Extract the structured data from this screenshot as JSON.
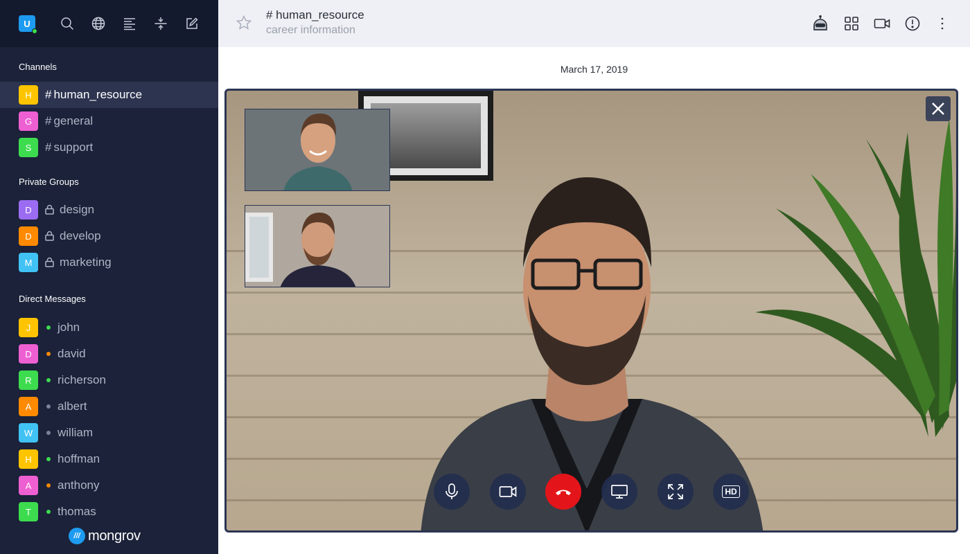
{
  "user": {
    "initial": "U",
    "status_color": "#3ee04a"
  },
  "toolbar": {
    "icons": [
      "search-icon",
      "globe-icon",
      "align-left-icon",
      "split-icon",
      "edit-icon"
    ]
  },
  "sidebar": {
    "channels_title": "Channels",
    "channels": [
      {
        "initial": "H",
        "color": "#ffc400",
        "label": "human_resource",
        "active": true
      },
      {
        "initial": "G",
        "color": "#ee5fd2",
        "label": "general"
      },
      {
        "initial": "S",
        "color": "#3ddc4f",
        "label": "support"
      }
    ],
    "groups_title": "Private Groups",
    "groups": [
      {
        "initial": "D",
        "color": "#9b6cf2",
        "label": "design"
      },
      {
        "initial": "D",
        "color": "#ff8a00",
        "label": "develop"
      },
      {
        "initial": "M",
        "color": "#41c2f5",
        "label": "marketing"
      }
    ],
    "dm_title": "Direct Messages",
    "dms": [
      {
        "initial": "J",
        "color": "#ffc400",
        "label": "john",
        "presence": "#3ddc4f"
      },
      {
        "initial": "D",
        "color": "#ee5fd2",
        "label": "david",
        "presence": "#ff8a00"
      },
      {
        "initial": "R",
        "color": "#3ddc4f",
        "label": "richerson",
        "presence": "#3ddc4f"
      },
      {
        "initial": "A",
        "color": "#ff8a00",
        "label": "albert",
        "presence": "#7c8398"
      },
      {
        "initial": "W",
        "color": "#41c2f5",
        "label": "william",
        "presence": "#7c8398"
      },
      {
        "initial": "H",
        "color": "#ffc400",
        "label": "hoffman",
        "presence": "#3ddc4f"
      },
      {
        "initial": "A",
        "color": "#ee5fd2",
        "label": "anthony",
        "presence": "#ff8a00"
      },
      {
        "initial": "T",
        "color": "#3ddc4f",
        "label": "thomas",
        "presence": "#3ddc4f"
      }
    ],
    "brand": {
      "logo": "///",
      "name": "mongrov"
    }
  },
  "header": {
    "channel_title": "# human_resource",
    "channel_subtitle": "career information",
    "icons": [
      "bot-icon",
      "grid-icon",
      "video-icon",
      "info-icon",
      "more-vertical-icon"
    ]
  },
  "main": {
    "date": "March 17, 2019",
    "call_controls": [
      "microphone-icon",
      "camera-icon",
      "end-call-icon",
      "screen-share-icon",
      "fullscreen-icon",
      "hd-icon"
    ],
    "hd_label": "HD"
  }
}
